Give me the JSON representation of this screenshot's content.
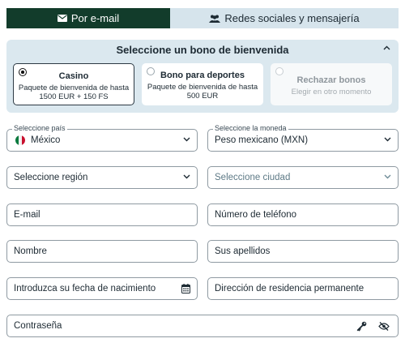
{
  "tabs": [
    {
      "label": "Por e-mail",
      "icon": "envelope-icon",
      "active": true
    },
    {
      "label": "Redes sociales y mensajería",
      "icon": "users-icon",
      "active": false
    }
  ],
  "bonus": {
    "title": "Seleccione un bono de bienvenida",
    "options": [
      {
        "title": "Casino",
        "subtitle": "Paquete de bienvenida de hasta 1500 EUR + 150 FS",
        "selected": true
      },
      {
        "title": "Bono para deportes",
        "subtitle": "Paquete de bienvenida de hasta 500 EUR",
        "selected": false
      },
      {
        "title": "Rechazar bonos",
        "subtitle": "Elegir en otro momento",
        "selected": false
      }
    ]
  },
  "form": {
    "country_label": "Seleccione país",
    "country_value": "México",
    "currency_label": "Seleccione la moneda",
    "currency_value": "Peso mexicano (MXN)",
    "region_placeholder": "Seleccione región",
    "city_placeholder": "Seleccione ciudad",
    "email_placeholder": "E-mail",
    "phone_placeholder": "Número de teléfono",
    "first_name_placeholder": "Nombre",
    "last_name_placeholder": "Sus apellidos",
    "birthdate_placeholder": "Introduzca su fecha de nacimiento",
    "address_placeholder": "Dirección de residencia permanente",
    "password_placeholder": "Contraseña"
  },
  "colors": {
    "active_tab": "#123c2b",
    "inactive_tab": "#d6e4ec",
    "panel": "#dbe8ef"
  }
}
